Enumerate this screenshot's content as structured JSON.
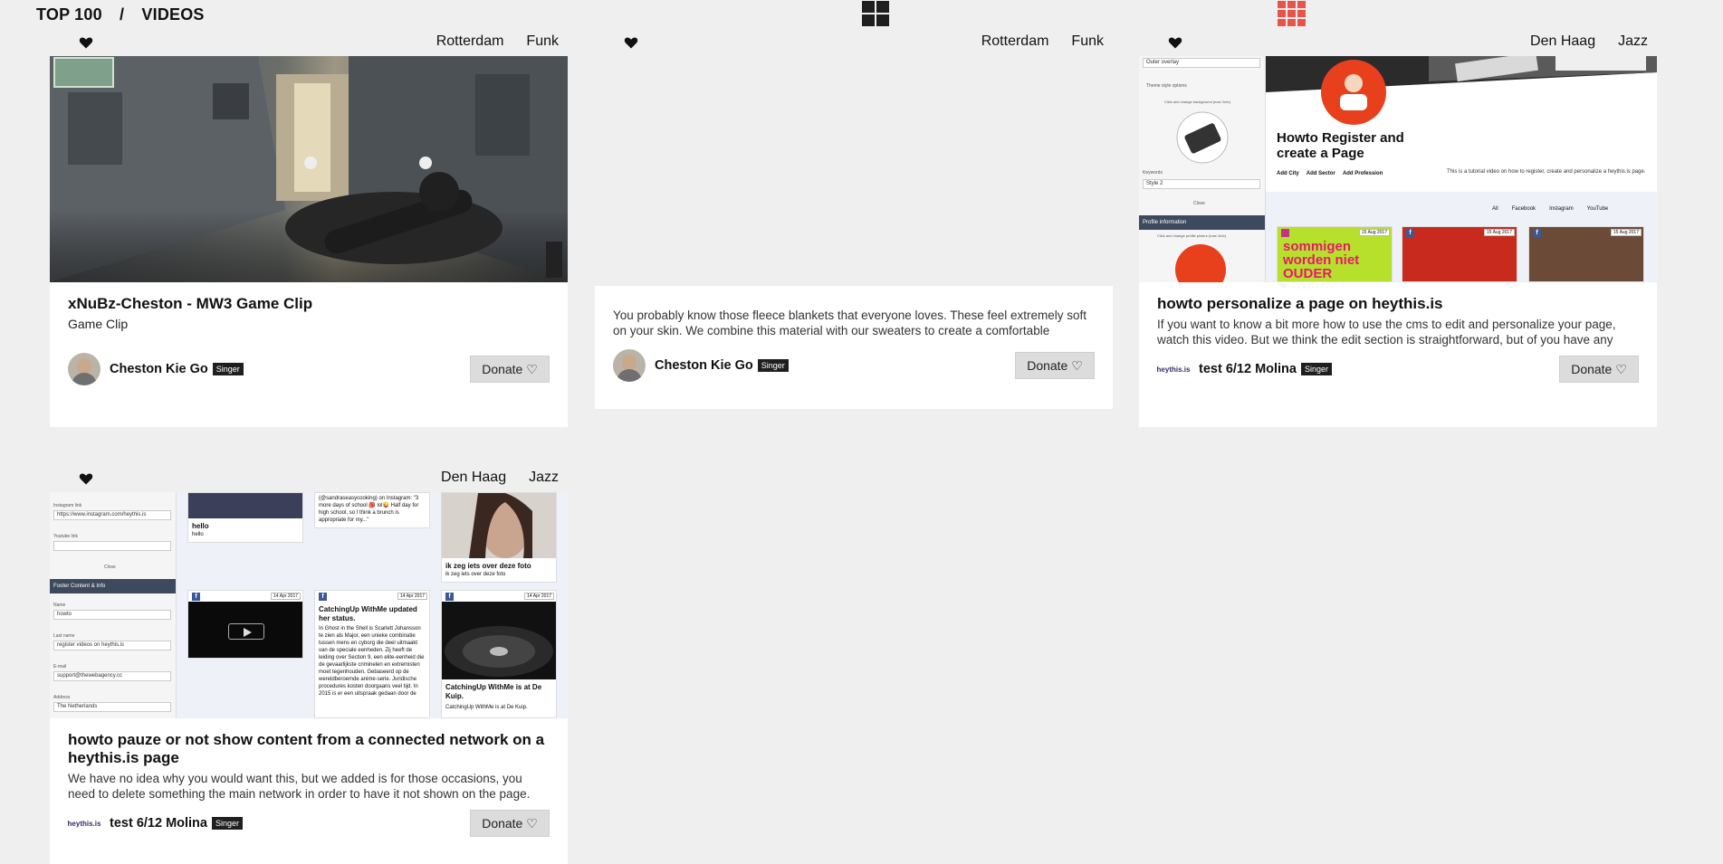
{
  "header": {
    "breadcrumb_section": "TOP 100",
    "breadcrumb_separator": "/",
    "breadcrumb_page": "VIDEOS"
  },
  "colors": {
    "accent_grid": "#e8544a",
    "badge": "#1f1f1f",
    "donate_bg": "#dcdcdc"
  },
  "cards": [
    {
      "city": "Rotterdam",
      "genre": "Funk",
      "title": "xNuBz-Cheston - MW3 Game Clip",
      "subtitle": "Game Clip",
      "description": "",
      "author": "Cheston Kie Go",
      "role": "Singer",
      "donate": "Donate ♡"
    },
    {
      "city": "Rotterdam",
      "genre": "Funk",
      "title": "",
      "subtitle": "",
      "description": "You probably know those fleece blankets that everyone loves. These feel extremely soft on your skin. We combine this material with our sweaters to create a comfortable",
      "author": "Cheston Kie Go",
      "role": "Singer",
      "donate": "Donate ♡"
    },
    {
      "city": "Den Haag",
      "genre": "Jazz",
      "title": "howto personalize a page on heythis.is",
      "subtitle": "",
      "description": "If you want to know a bit more how to use the cms to edit and personalize your page, watch this video. But we think the edit section is straightforward, but of you have any",
      "author": "test 6/12 Molina",
      "role": "Singer",
      "author_logo": "heythis.is",
      "donate": "Donate ♡",
      "thumb": {
        "field_value": "Outer overlay",
        "theme_label": "Theme style options",
        "bg_label": "Click and change background (max 2mb)",
        "keywords_label": "Keywords",
        "style_value": "Style 2",
        "close": "Close",
        "profile_bar": "Profile information",
        "profile_pic_label": "Click and change profile picture (max 2mb)",
        "page_title": "Howto Register and create a Page",
        "add_city": "Add City",
        "add_sector": "Add Sector",
        "add_profession": "Add Profession",
        "page_desc": "This is a tutorial video on how to register, create and personalize a heythis.is page.",
        "filters": [
          "All",
          "Facebook",
          "Instagram",
          "YouTube"
        ],
        "date": "15 Aug 2017",
        "poster_text": "sommigen worden niet OUDER"
      }
    },
    {
      "city": "Den Haag",
      "genre": "Jazz",
      "title": "howto pauze or not show content from a connected network on a heythis.is page",
      "subtitle": "",
      "description": "We have no idea why you would want this, but we added is for those occasions, you need to delete something the main network in order to have it not shown on the page.",
      "author": "test 6/12 Molina",
      "role": "Singer",
      "author_logo": "heythis.is",
      "donate": "Donate ♡",
      "thumb": {
        "instagram_label": "Instagram link",
        "instagram_value": "https://www.instagram.com/heythis.is",
        "youtube_label": "Youtube link",
        "close": "Close",
        "footer_bar": "Footer Content & Info",
        "name_label": "Name",
        "name_value": "howto",
        "lastname_label": "Last name",
        "lastname_value": "register videos on heythis.is",
        "email_label": "E-mail",
        "email_value": "support@thewebagency.cc",
        "address_label": "Address",
        "address_value": "The Netherlands",
        "hello_title": "hello",
        "hello_text": "hello",
        "quote_text": "(@sandraseasycooking) on Instagram: \"3 more days of school 🎒 lol😜 Half day for high school, so I think a brunch is appropriate for my...\"",
        "foto_title": "ik zeg iets over deze foto",
        "foto_text": "ik zeg iets over deze foto",
        "date": "14 Apr 2017",
        "news_title": "CatchingUp WithMe updated her status.",
        "news_text": "In Ghost in the Shell is Scarlett Johansson te zien als Major, een unieke combinatie tussen mens en cyborg die deel uitmaakt van de speciale eenheden. Zij heeft de leiding over Section 9, een elite-eenheid die de gevaarlijkste criminelen en extremisten moet tegenhouden. Gebaseerd op de wereldberoemde anime-serie. Juridische procedures kosten doorgaans veel tijd. In 2015 is er een uitspraak gedaan door de",
        "kuip_title": "CatchingUp WithMe is at De Kuip.",
        "kuip_text": "CatchingUp WithMe is at De Kuip."
      }
    }
  ]
}
